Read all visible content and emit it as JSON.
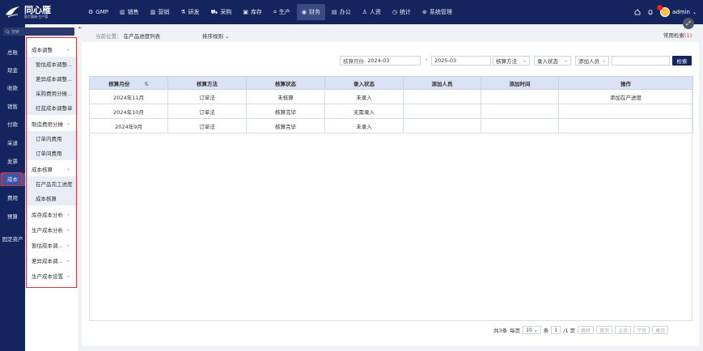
{
  "app": {
    "brand": "同心雁",
    "brand_sub": "医疗器械·生产版"
  },
  "topnav": [
    {
      "label": "GMP",
      "icon": "gear-icon"
    },
    {
      "label": "销售",
      "icon": "bar-chart-icon"
    },
    {
      "label": "营销",
      "icon": "bar-chart-icon"
    },
    {
      "label": "研发",
      "icon": "flask-icon"
    },
    {
      "label": "采购",
      "icon": "cart-icon"
    },
    {
      "label": "库存",
      "icon": "box-icon"
    },
    {
      "label": "生产",
      "icon": "factory-icon"
    },
    {
      "label": "财务",
      "icon": "coin-icon",
      "active": true
    },
    {
      "label": "办公",
      "icon": "briefcase-icon"
    },
    {
      "label": "人资",
      "icon": "person-icon"
    },
    {
      "label": "统计",
      "icon": "clock-icon"
    },
    {
      "label": "系统管理",
      "icon": "settings-icon"
    }
  ],
  "user": {
    "name": "admin"
  },
  "sidebar": {
    "search_placeholder": "搜索",
    "items": [
      "总账",
      "现金",
      "收款",
      "销售",
      "付款",
      "采退",
      "发票",
      "成本",
      "费用",
      "预算",
      "固定资产"
    ],
    "active_index": 7
  },
  "submenu": {
    "groups": [
      {
        "label": "成本调整",
        "expanded": true,
        "items": [
          "暂估成本调整...",
          "差异成本调整...",
          "采购费用分摊...",
          "红蓝成本调整单"
        ]
      },
      {
        "label": "制造费用分摊",
        "expanded": true,
        "items": [
          "订单内费用",
          "订单间费用"
        ]
      },
      {
        "label": "成本核算",
        "expanded": true,
        "items": [
          "在产品完工进度",
          "成本核算"
        ]
      },
      {
        "label": "库存成本分析",
        "expanded": false,
        "items": []
      },
      {
        "label": "生产成本分析",
        "expanded": false,
        "items": []
      },
      {
        "label": "暂估成本调...",
        "expanded": false,
        "items": []
      },
      {
        "label": "差异成本调...",
        "expanded": false,
        "items": []
      },
      {
        "label": "生产成本设置",
        "expanded": false,
        "items": []
      }
    ]
  },
  "breadcrumb": {
    "prefix": "当前位置：",
    "page": "在产品进度列表"
  },
  "sort_rule": "排序规则",
  "common_search": {
    "label": "常用检索",
    "count": "(1)"
  },
  "filters": {
    "month_label": "核算月份:",
    "month_from": "2024-03",
    "dash": "-",
    "month_to": "2025-03",
    "method_placeholder": "核算方法",
    "entry_status_placeholder": "录入状态",
    "adder_placeholder": "添加人员",
    "search_button": "检索"
  },
  "table": {
    "columns": [
      "核算月份",
      "核算方法",
      "核算状态",
      "录入状态",
      "添加人员",
      "添加时间",
      "操作"
    ],
    "rows": [
      [
        "2024年11月",
        "订单法",
        "未核算",
        "未录入",
        "",
        "",
        "添加在产进度"
      ],
      [
        "2024年10月",
        "订单法",
        "核算完毕",
        "无需录入",
        "",
        "",
        ""
      ],
      [
        "2024年9月",
        "订单法",
        "核算完毕",
        "未录入",
        "",
        "",
        ""
      ]
    ]
  },
  "pager": {
    "total": "共3条",
    "per_page_label": "每页",
    "per_page": "10",
    "unit": "条",
    "page": "1",
    "of_pages": "/1 页",
    "jump": "跳转",
    "first": "首页",
    "prev": "上页",
    "next": "下页",
    "last": "尾页"
  },
  "colors": {
    "nav_bg": "#14245e",
    "accent": "#3a56a8",
    "highlight": "#e03333",
    "header_row": "#d9e3f5"
  }
}
